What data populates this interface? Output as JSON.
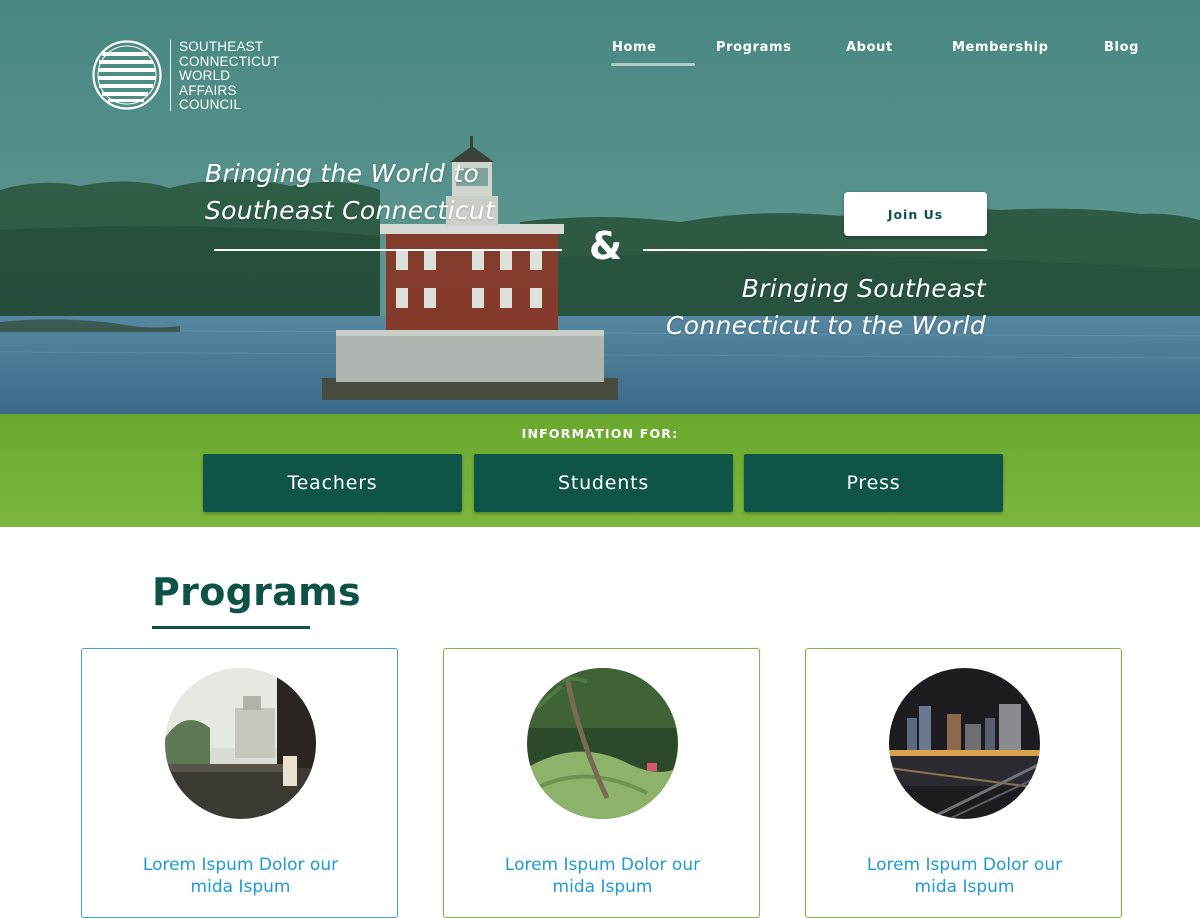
{
  "brand": {
    "logo_icon": "globe-stripes-icon",
    "name_lines": [
      "SOUTHEAST",
      "CONNECTICUT",
      "WORLD",
      "AFFAIRS",
      "COUNCIL"
    ]
  },
  "nav": {
    "active": "Home",
    "items": [
      {
        "label": "Home"
      },
      {
        "label": "Programs"
      },
      {
        "label": "About"
      },
      {
        "label": "Membership"
      },
      {
        "label": "Blog"
      }
    ]
  },
  "hero": {
    "tagline_left": [
      "Bringing the World to",
      "Southeast Connecticut"
    ],
    "ampersand": "&",
    "tagline_right": [
      "Bringing Southeast",
      "Connecticut to the World"
    ],
    "join_label": "Join Us"
  },
  "info": {
    "label": "INFORMATION FOR:",
    "buttons": [
      {
        "label": "Teachers"
      },
      {
        "label": "Students"
      },
      {
        "label": "Press"
      }
    ]
  },
  "programs": {
    "title": "Programs",
    "cards": [
      {
        "title": "Lorem Ispum Dolor our mida Ispum"
      },
      {
        "title": "Lorem Ispum Dolor our mida Ispum"
      },
      {
        "title": "Lorem Ispum Dolor our mida Ispum"
      }
    ]
  },
  "colors": {
    "primary_dark_green": "#0e5447",
    "band_green": "#6aa82d",
    "link_blue": "#1e9ad4",
    "card_border_blue": "#38a8d6",
    "card_border_green": "#7bb73d"
  }
}
